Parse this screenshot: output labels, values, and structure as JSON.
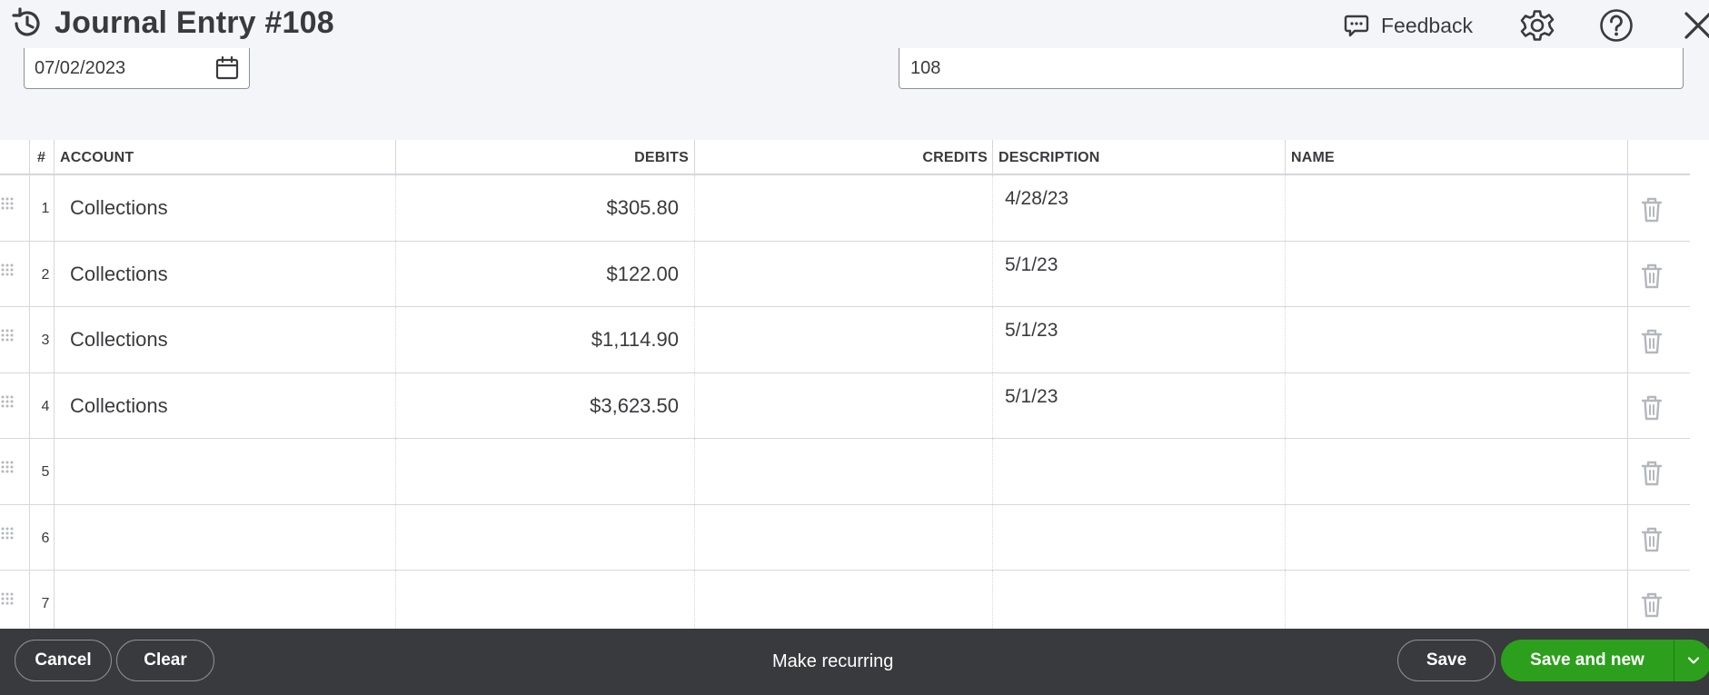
{
  "header": {
    "title": "Journal Entry #108",
    "feedback_label": "Feedback"
  },
  "form": {
    "date_value": "07/02/2023",
    "journal_no_value": "108"
  },
  "table": {
    "columns": {
      "num": "#",
      "account": "ACCOUNT",
      "debits": "DEBITS",
      "credits": "CREDITS",
      "description": "DESCRIPTION",
      "name": "NAME"
    },
    "rows": [
      {
        "num": "1",
        "account": "Collections",
        "debit": "$305.80",
        "credit": "",
        "description": "4/28/23",
        "name": ""
      },
      {
        "num": "2",
        "account": "Collections",
        "debit": "$122.00",
        "credit": "",
        "description": "5/1/23",
        "name": ""
      },
      {
        "num": "3",
        "account": "Collections",
        "debit": "$1,114.90",
        "credit": "",
        "description": "5/1/23",
        "name": ""
      },
      {
        "num": "4",
        "account": "Collections",
        "debit": "$3,623.50",
        "credit": "",
        "description": "5/1/23",
        "name": ""
      },
      {
        "num": "5",
        "account": "",
        "debit": "",
        "credit": "",
        "description": "",
        "name": ""
      },
      {
        "num": "6",
        "account": "",
        "debit": "",
        "credit": "",
        "description": "",
        "name": ""
      },
      {
        "num": "7",
        "account": "",
        "debit": "",
        "credit": "",
        "description": "",
        "name": ""
      }
    ]
  },
  "footer": {
    "cancel_label": "Cancel",
    "clear_label": "Clear",
    "make_recurring_label": "Make recurring",
    "save_label": "Save",
    "save_and_new_label": "Save and new"
  },
  "icons": {
    "history": "history-icon",
    "feedback": "chat-bubble-icon",
    "settings": "gear-icon",
    "help": "question-circle-icon",
    "close": "close-icon",
    "calendar": "calendar-icon",
    "drag": "drag-handle-icon",
    "delete": "trash-icon",
    "dropdown": "chevron-down-icon"
  },
  "colors": {
    "primary_green": "#2ca01c",
    "footer_bg": "#393a3d",
    "header_bg": "#f4f5f8",
    "text": "#393a3d"
  }
}
